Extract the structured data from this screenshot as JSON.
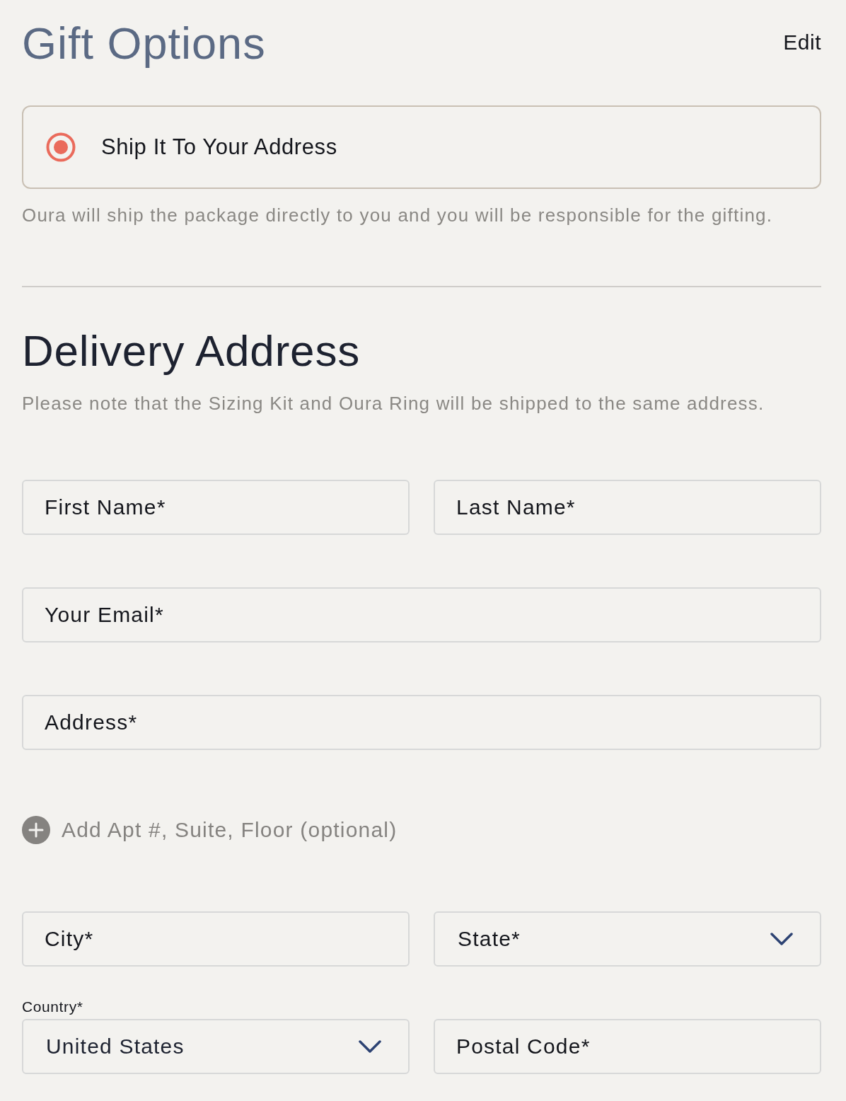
{
  "header": {
    "title": "Gift Options",
    "edit_link": "Edit"
  },
  "gift_options": [
    {
      "label": "Ship It To Your Address",
      "selected": true
    }
  ],
  "gift_note": "Oura will ship the package directly to you and you will be responsible for the gifting.",
  "delivery": {
    "title": "Delivery Address",
    "note": "Please note that the Sizing Kit and Oura Ring will be shipped to the same address."
  },
  "form": [
    {
      "kind": "fields",
      "fields": [
        {
          "kind": "text",
          "placeholder": "First Name*"
        },
        {
          "kind": "text",
          "placeholder": "Last Name*"
        }
      ]
    },
    {
      "kind": "fields",
      "fields": [
        {
          "kind": "text",
          "placeholder": "Your Email*"
        }
      ]
    },
    {
      "kind": "fields",
      "fields": [
        {
          "kind": "text",
          "placeholder": "Address*"
        }
      ]
    },
    {
      "kind": "add_link",
      "label": "Add Apt #, Suite, Floor (optional)"
    },
    {
      "kind": "fields",
      "fields": [
        {
          "kind": "text",
          "placeholder": "City*"
        },
        {
          "kind": "select",
          "placeholder": "State*"
        }
      ]
    },
    {
      "kind": "fields",
      "fields": [
        {
          "kind": "select",
          "label": "Country*",
          "value": "United States"
        },
        {
          "kind": "text",
          "placeholder": "Postal Code*"
        }
      ]
    }
  ]
}
